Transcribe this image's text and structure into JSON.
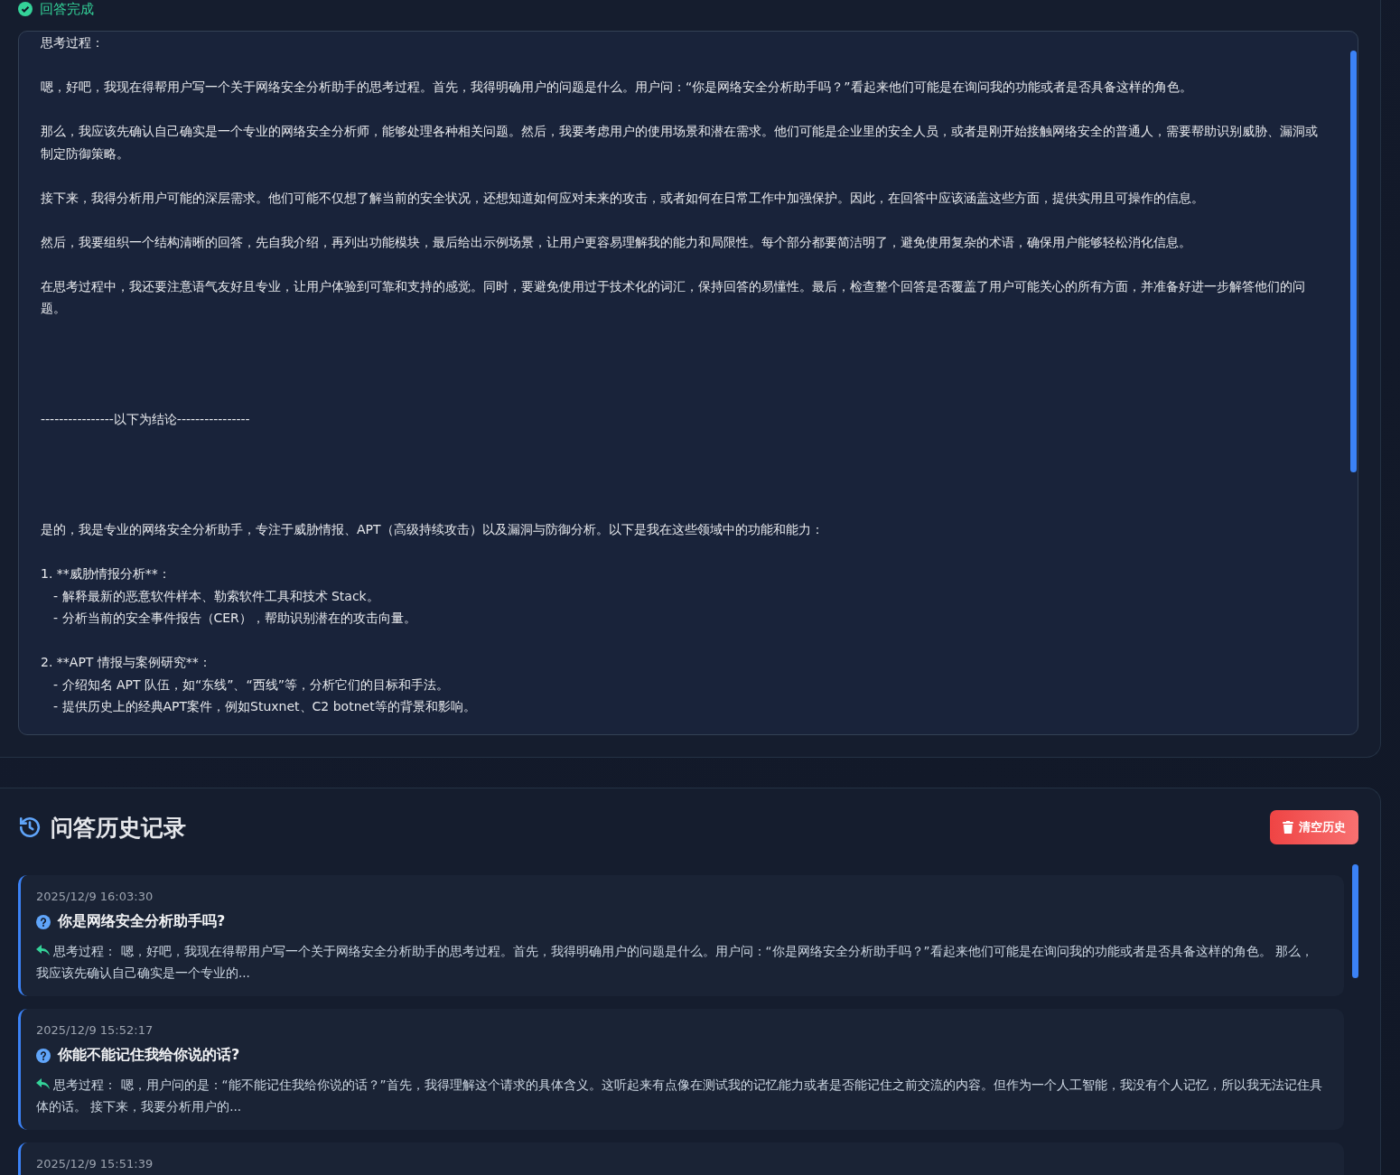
{
  "status": {
    "label": "回答完成",
    "done": true
  },
  "answer": {
    "blocks": [
      {
        "kind": "paragraph",
        "text": "思考过程："
      },
      {
        "kind": "paragraph",
        "text": "嗯，好吧，我现在得帮用户写一个关于网络安全分析助手的思考过程。首先，我得明确用户的问题是什么。用户问：“你是网络安全分析助手吗？”看起来他们可能是在询问我的功能或者是否具备这样的角色。"
      },
      {
        "kind": "paragraph",
        "text": "那么，我应该先确认自己确实是一个专业的网络安全分析师，能够处理各种相关问题。然后，我要考虑用户的使用场景和潜在需求。他们可能是企业里的安全人员，或者是刚开始接触网络安全的普通人，需要帮助识别威胁、漏洞或制定防御策略。"
      },
      {
        "kind": "paragraph",
        "text": "接下来，我得分析用户可能的深层需求。他们可能不仅想了解当前的安全状况，还想知道如何应对未来的攻击，或者如何在日常工作中加强保护。因此，在回答中应该涵盖这些方面，提供实用且可操作的信息。"
      },
      {
        "kind": "paragraph",
        "text": "然后，我要组织一个结构清晰的回答，先自我介绍，再列出功能模块，最后给出示例场景，让用户更容易理解我的能力和局限性。每个部分都要简洁明了，避免使用复杂的术语，确保用户能够轻松消化信息。"
      },
      {
        "kind": "paragraph",
        "text": "在思考过程中，我还要注意语气友好且专业，让用户体验到可靠和支持的感觉。同时，要避免使用过于技术化的词汇，保持回答的易懂性。最后，检查整个回答是否覆盖了用户可能关心的所有方面，并准备好进一步解答他们的问题。"
      },
      {
        "kind": "divider",
        "text": "----------------以下为结论----------------"
      },
      {
        "kind": "paragraph",
        "text": "是的，我是专业的网络安全分析助手，专注于威胁情报、APT（高级持续攻击）以及漏洞与防御分析。以下是我在这些领域中的功能和能力："
      },
      {
        "kind": "paragraph",
        "text": "1. **威胁情报分析**："
      },
      {
        "kind": "bullet",
        "text": "- 解释最新的恶意软件样本、勒索软件工具和技术 Stack。"
      },
      {
        "kind": "bullet",
        "text": "- 分析当前的安全事件报告（CER），帮助识别潜在的攻击向量。"
      },
      {
        "kind": "paragraph",
        "text": "2. **APT 情报与案例研究**："
      },
      {
        "kind": "bullet",
        "text": "- 介绍知名 APT 队伍，如“东线”、“西线”等，分析它们的目标和手法。"
      },
      {
        "kind": "bullet",
        "text": "- 提供历史上的经典APT案件，例如Stuxnet、C2 botnet等的背景和影响。"
      }
    ]
  },
  "history": {
    "title": "问答历史记录",
    "clear_button": "清空历史",
    "items": [
      {
        "time": "2025/12/9 16:03:30",
        "question": "你是网络安全分析助手吗?",
        "answer": "思考过程： 嗯，好吧，我现在得帮用户写一个关于网络安全分析助手的思考过程。首先，我得明确用户的问题是什么。用户问：“你是网络安全分析助手吗？”看起来他们可能是在询问我的功能或者是否具备这样的角色。 那么，我应该先确认自己确实是一个专业的..."
      },
      {
        "time": "2025/12/9 15:52:17",
        "question": "你能不能记住我给你说的话?",
        "answer": "思考过程： 嗯，用户问的是：“能不能记住我给你说的话？”首先，我得理解这个请求的具体含义。这听起来有点像在测试我的记忆能力或者是否能记住之前交流的内容。但作为一个人工智能，我没有个人记忆，所以我无法记住具体的话。 接下来，我要分析用户的..."
      },
      {
        "time": "2025/12/9 15:51:39"
      }
    ]
  }
}
